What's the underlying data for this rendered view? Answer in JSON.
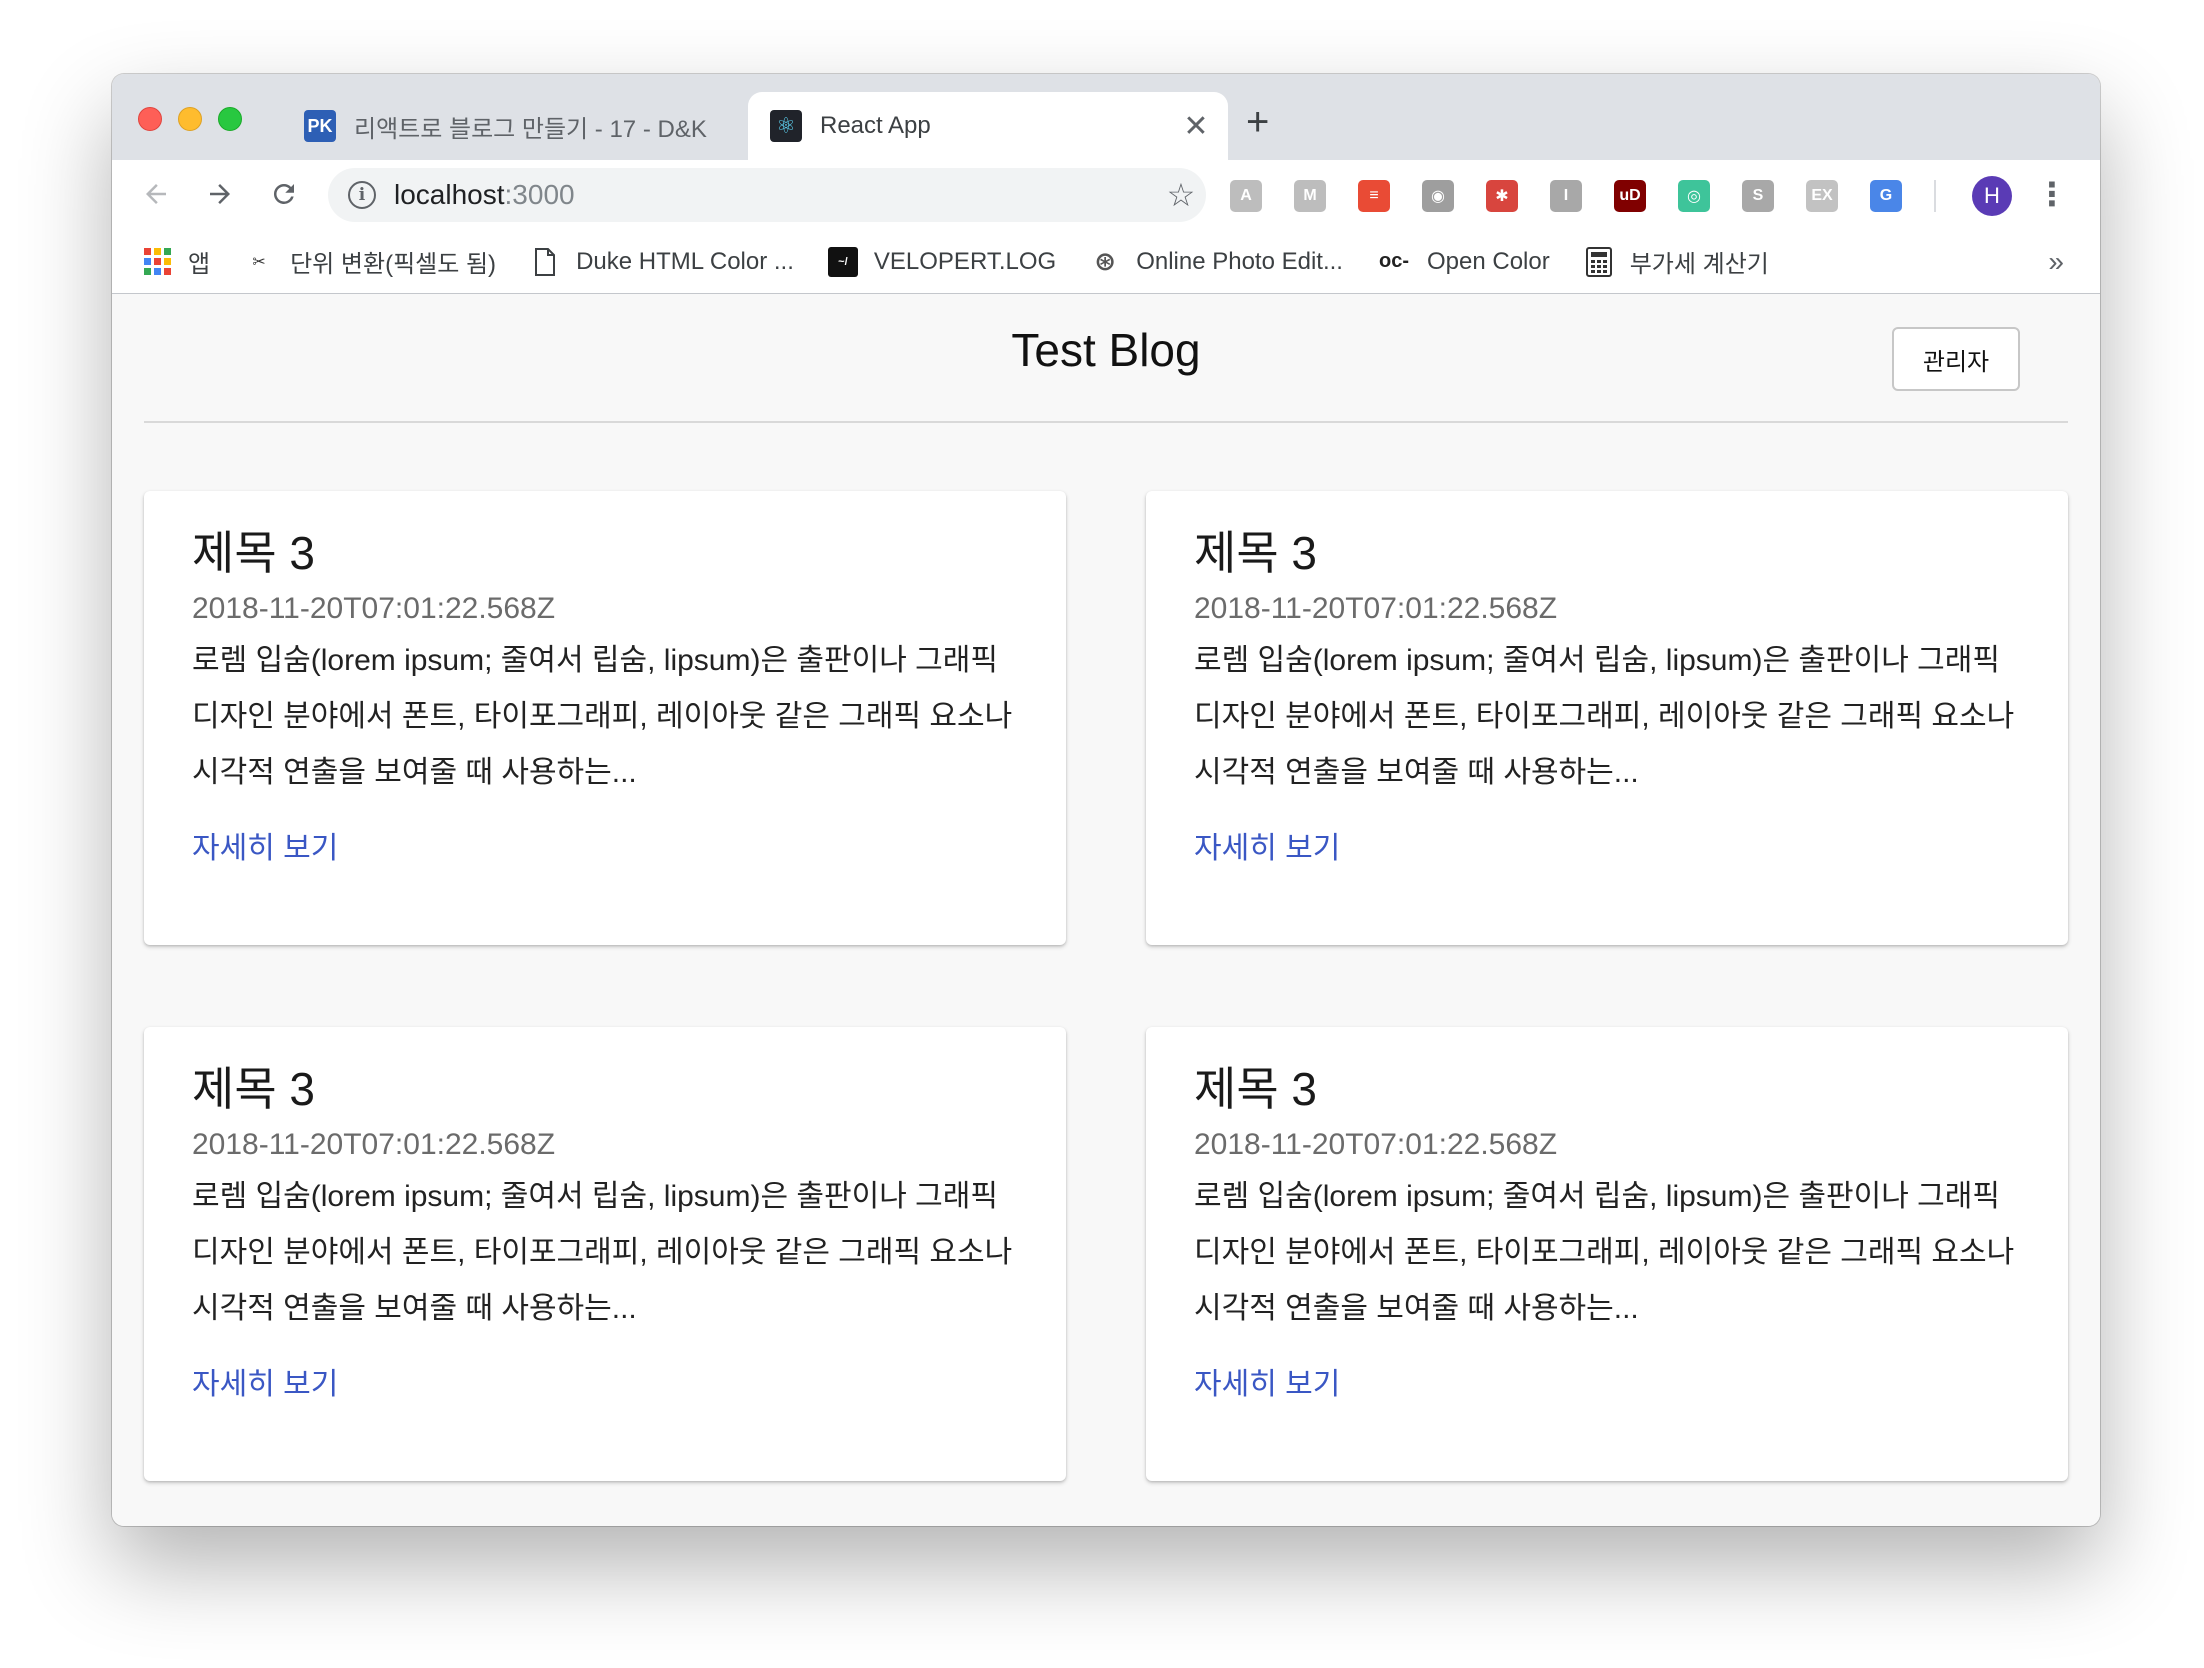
{
  "browser": {
    "tabs": [
      {
        "title": "리액트로 블로그 만들기 - 17 - D&K",
        "favicon": "PK",
        "active": false
      },
      {
        "title": "React App",
        "favicon": "⚛",
        "active": true
      }
    ],
    "new_tab_label": "+",
    "close_label": "✕",
    "address": {
      "host": "localhost",
      "port": ":3000"
    },
    "profile_initial": "H",
    "extensions": [
      {
        "name": "adblock-icon",
        "glyph": "A",
        "color": "#bdbdbd"
      },
      {
        "name": "reader-icon",
        "glyph": "M",
        "color": "#bdbdbd"
      },
      {
        "name": "pocket-list-icon",
        "glyph": "≡",
        "color": "#e94b35"
      },
      {
        "name": "brain-icon",
        "glyph": "◉",
        "color": "#9e9e9e"
      },
      {
        "name": "react-devtools-icon",
        "glyph": "✱",
        "color": "#d8453e"
      },
      {
        "name": "ext-i-icon",
        "glyph": "I",
        "color": "#a8a8a8"
      },
      {
        "name": "ublock-icon",
        "glyph": "uD",
        "color": "#800000"
      },
      {
        "name": "target-icon",
        "glyph": "◎",
        "color": "#3ec49a"
      },
      {
        "name": "s-icon",
        "glyph": "S",
        "color": "#a8a8a8"
      },
      {
        "name": "ex-icon",
        "glyph": "EX",
        "color": "#c2c2c2"
      },
      {
        "name": "translate-icon",
        "glyph": "G",
        "color": "#4a86e8"
      }
    ],
    "bookmarks": [
      {
        "label": "앱",
        "icon": "apps-grid-icon"
      },
      {
        "label": "단위 변환(픽셀도 됨)",
        "icon": "tool-icon"
      },
      {
        "label": "Duke HTML Color ...",
        "icon": "document-icon"
      },
      {
        "label": "VELOPERT.LOG",
        "icon": "velopert-icon"
      },
      {
        "label": "Online Photo Edit...",
        "icon": "aperture-icon"
      },
      {
        "label": "Open Color",
        "icon": "oc-icon"
      },
      {
        "label": "부가세 계산기",
        "icon": "calculator-icon"
      }
    ],
    "bookmarks_more": "»"
  },
  "page": {
    "title": "Test Blog",
    "admin_button": "관리자",
    "posts": [
      {
        "title": "제목 3",
        "date": "2018-11-20T07:01:22.568Z",
        "excerpt": "로렘 입숨(lorem ipsum; 줄여서 립숨, lipsum)은 출판이나 그래픽 디자인 분야에서 폰트, 타이포그래피, 레이아웃 같은 그래픽 요소나 시각적 연출을 보여줄 때 사용하는...",
        "link": "자세히 보기"
      },
      {
        "title": "제목 3",
        "date": "2018-11-20T07:01:22.568Z",
        "excerpt": "로렘 입숨(lorem ipsum; 줄여서 립숨, lipsum)은 출판이나 그래픽 디자인 분야에서 폰트, 타이포그래피, 레이아웃 같은 그래픽 요소나 시각적 연출을 보여줄 때 사용하는...",
        "link": "자세히 보기"
      },
      {
        "title": "제목 3",
        "date": "2018-11-20T07:01:22.568Z",
        "excerpt": "로렘 입숨(lorem ipsum; 줄여서 립숨, lipsum)은 출판이나 그래픽 디자인 분야에서 폰트, 타이포그래피, 레이아웃 같은 그래픽 요소나 시각적 연출을 보여줄 때 사용하는...",
        "link": "자세히 보기"
      },
      {
        "title": "제목 3",
        "date": "2018-11-20T07:01:22.568Z",
        "excerpt": "로렘 입숨(lorem ipsum; 줄여서 립숨, lipsum)은 출판이나 그래픽 디자인 분야에서 폰트, 타이포그래피, 레이아웃 같은 그래픽 요소나 시각적 연출을 보여줄 때 사용하는...",
        "link": "자세히 보기"
      }
    ]
  }
}
